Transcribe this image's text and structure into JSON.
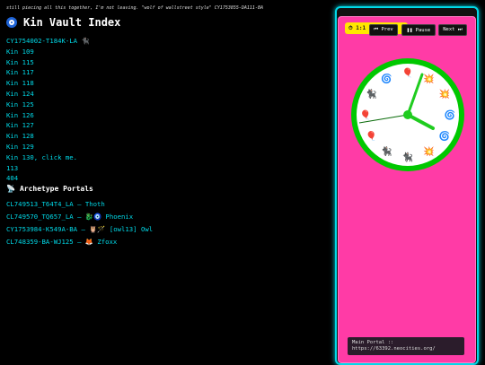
{
  "banner": "still piecing all this together, I'm not leaving. \"wolf of wallstreet style\" CY1753855-DA111-BA",
  "page_title": "Kin Vault Index",
  "kin_items": [
    "CY1754002-T184K-LA 🐈‍⬛",
    "Kin 109",
    "Kin 115",
    "Kin 117",
    "Kin 118",
    "Kin 124",
    "Kin 125",
    "Kin 126",
    "Kin 127",
    "Kin 128",
    "Kin 129",
    "Kin 130, click me.",
    "113",
    "404"
  ],
  "portals_heading": "Archetype Portals",
  "portals": [
    "CL749513_T64T4_LA — Thoth",
    "CL749570_TQ657_LA — 🐉🧿 Phoenix",
    "CY1753984-K549A-BA — 🦉🪄 [owl13] Owl",
    "CL748359-BA-WJ125 — 🦊 Zfoxx"
  ],
  "widget": {
    "timer": "⏱ 1:1",
    "prev_label": "⏮ Prev",
    "pause_label": "❚❚ Pause",
    "next_label": "Next ⏭",
    "portal_label": "Main Portal ::",
    "portal_url": "https://63392.neocities.org/",
    "clock_icons": [
      "🎈",
      "💥",
      "💥",
      "🌀",
      "🌀",
      "💥",
      "🐈‍⬛",
      "🐈‍⬛",
      "🎈",
      "🎈",
      "🐈‍⬛",
      "🌀"
    ]
  },
  "colors": {
    "accent": "#00d9e8",
    "panel": "#ff3ba6",
    "clock_ring": "#00c800",
    "timer": "#ffe800"
  }
}
